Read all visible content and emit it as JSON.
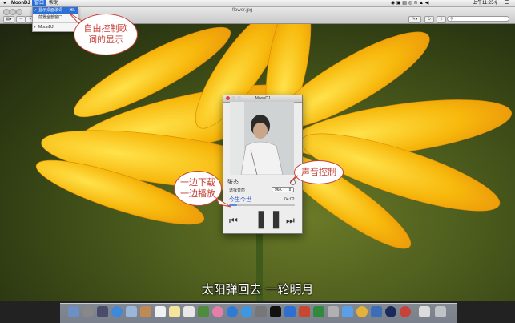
{
  "menubar": {
    "app_name": "MoonDJ",
    "menu_window": "窗口",
    "menu_help": "帮助",
    "clock": "上午11:25"
  },
  "dropdown": {
    "items": [
      {
        "label": "显示桌面歌词",
        "shortcut": "⌘L",
        "checked": true,
        "selected": true
      },
      {
        "label": "前置全部窗口",
        "shortcut": "",
        "checked": false,
        "selected": false
      },
      {
        "label": "MoonDJ",
        "shortcut": "",
        "checked": true,
        "selected": false
      }
    ]
  },
  "window": {
    "title": "flower.jpg"
  },
  "callouts": {
    "lyrics": [
      "自由控制歌",
      "词的显示"
    ],
    "download": [
      "一边下载",
      "一边播放"
    ],
    "volume": "声音控制"
  },
  "player": {
    "title": "MoonDJ",
    "artist": "张杰",
    "quality_label": "选择音质",
    "quality_value": "96K",
    "song_title": "今生今世",
    "time": "04:02",
    "progress": 0.12
  },
  "lyrics_line": "太阳弹回去 一轮明月",
  "colors": {
    "accent": "#2b6fd8",
    "callout_red": "#c6423a",
    "song_blue": "#3a63c8"
  }
}
